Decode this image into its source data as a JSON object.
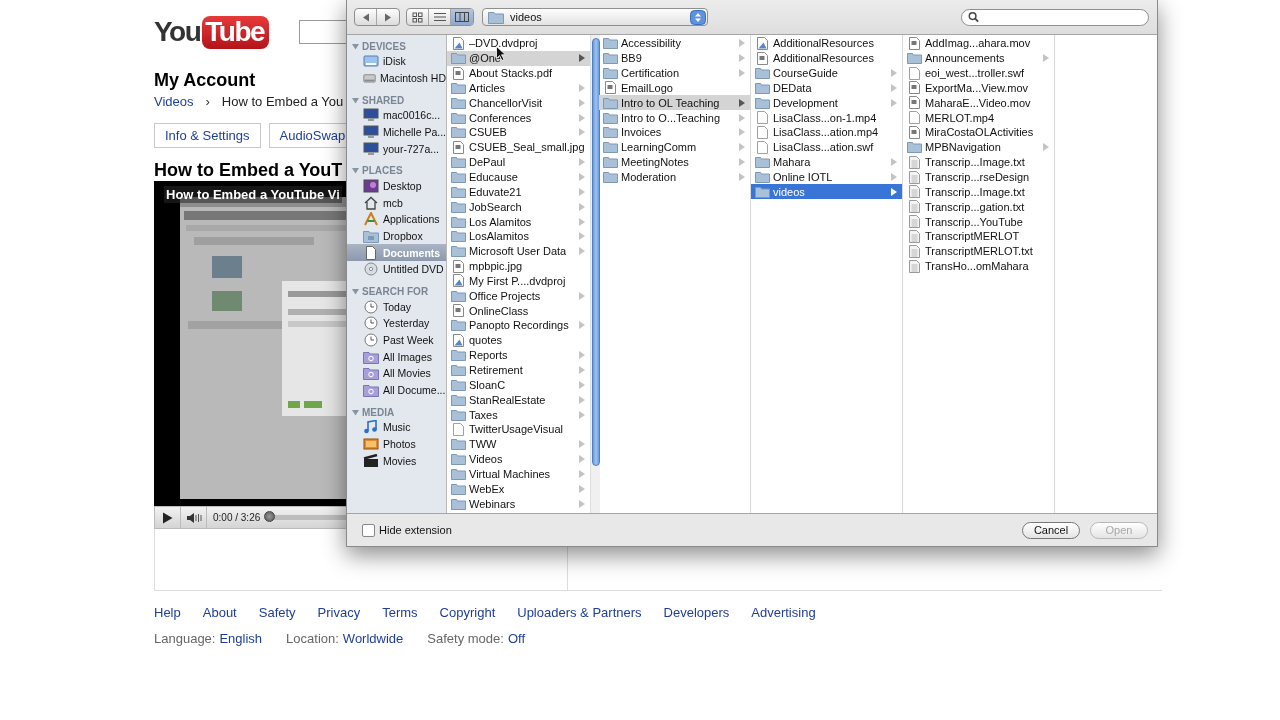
{
  "youtube": {
    "logo": {
      "you": "You",
      "tube": "Tube"
    },
    "heading": "My Account",
    "breadcrumb": {
      "link": "Videos",
      "separator": "›",
      "current": "How to Embed a You"
    },
    "tabs": [
      {
        "label": "Info & Settings"
      },
      {
        "label": "AudioSwap"
      }
    ],
    "video_title": "How to Embed a YouT",
    "player": {
      "overlay_title": "How to Embed a YouTube Vi",
      "time": "0:00 / 3:26"
    },
    "footer_links": [
      "Help",
      "About",
      "Safety",
      "Privacy",
      "Terms",
      "Copyright",
      "Uploaders & Partners",
      "Developers",
      "Advertising"
    ],
    "footer_settings": [
      {
        "label": "Language:",
        "value": "English"
      },
      {
        "label": "Location:",
        "value": "Worldwide"
      },
      {
        "label": "Safety mode:",
        "value": "Off"
      }
    ]
  },
  "dialog": {
    "views": [
      {
        "kind": "icon",
        "selected": false
      },
      {
        "kind": "list",
        "selected": false
      },
      {
        "kind": "columns",
        "selected": true
      }
    ],
    "path": "videos",
    "sidebar": [
      {
        "title": "DEVICES",
        "expanded": true,
        "items": [
          {
            "label": "iDisk",
            "kind": "idisk",
            "selected": false
          },
          {
            "label": "Macintosh HD",
            "kind": "harddisk",
            "selected": false
          }
        ]
      },
      {
        "title": "SHARED",
        "expanded": true,
        "items": [
          {
            "label": "mac0016c...",
            "kind": "computer",
            "selected": false
          },
          {
            "label": "Michelle Pa...",
            "kind": "computer",
            "selected": false
          },
          {
            "label": "your-727a...",
            "kind": "computer",
            "selected": false
          }
        ]
      },
      {
        "title": "PLACES",
        "expanded": true,
        "items": [
          {
            "label": "Desktop",
            "kind": "desktop",
            "selected": false
          },
          {
            "label": "mcb",
            "kind": "home",
            "selected": false
          },
          {
            "label": "Applications",
            "kind": "applications",
            "selected": false
          },
          {
            "label": "Dropbox",
            "kind": "folder",
            "selected": false
          },
          {
            "label": "Documents",
            "kind": "documents",
            "selected": true
          },
          {
            "label": "Untitled DVD",
            "kind": "dvd",
            "selected": false
          }
        ]
      },
      {
        "title": "SEARCH FOR",
        "expanded": true,
        "items": [
          {
            "label": "Today",
            "kind": "clock",
            "selected": false
          },
          {
            "label": "Yesterday",
            "kind": "clock",
            "selected": false
          },
          {
            "label": "Past Week",
            "kind": "clock",
            "selected": false
          },
          {
            "label": "All Images",
            "kind": "smart",
            "selected": false
          },
          {
            "label": "All Movies",
            "kind": "smart",
            "selected": false
          },
          {
            "label": "All Docume...",
            "kind": "smart",
            "selected": false
          }
        ]
      },
      {
        "title": "MEDIA",
        "expanded": true,
        "items": [
          {
            "label": "Music",
            "kind": "music",
            "selected": false
          },
          {
            "label": "Photos",
            "kind": "photos",
            "selected": false
          },
          {
            "label": "Movies",
            "kind": "movies",
            "selected": false
          }
        ]
      }
    ],
    "columns": [
      {
        "items": [
          {
            "name": "–DVD.dvdproj",
            "kind": "project",
            "selected": false
          },
          {
            "name": "@One",
            "kind": "folder",
            "selected": true
          },
          {
            "name": "About Stacks.pdf",
            "kind": "document",
            "selected": false
          },
          {
            "name": "Articles",
            "kind": "folder",
            "selected": false
          },
          {
            "name": "ChancellorVisit",
            "kind": "folder",
            "selected": false
          },
          {
            "name": "Conferences",
            "kind": "folder",
            "selected": false
          },
          {
            "name": "CSUEB",
            "kind": "folder",
            "selected": false
          },
          {
            "name": "CSUEB_Seal_small.jpg",
            "kind": "document",
            "selected": false
          },
          {
            "name": "DePaul",
            "kind": "folder",
            "selected": false
          },
          {
            "name": "Educause",
            "kind": "folder",
            "selected": false
          },
          {
            "name": "Eduvate21",
            "kind": "folder",
            "selected": false
          },
          {
            "name": "JobSearch",
            "kind": "folder",
            "selected": false
          },
          {
            "name": "Los Alamitos",
            "kind": "folder",
            "selected": false
          },
          {
            "name": "LosAlamitos",
            "kind": "folder",
            "selected": false
          },
          {
            "name": "Microsoft User Data",
            "kind": "folder",
            "selected": false
          },
          {
            "name": "mpbpic.jpg",
            "kind": "document",
            "selected": false
          },
          {
            "name": "My First P....dvdproj",
            "kind": "project",
            "selected": false
          },
          {
            "name": "Office Projects",
            "kind": "folder",
            "selected": false
          },
          {
            "name": "OnlineClass",
            "kind": "document",
            "selected": false
          },
          {
            "name": "Panopto Recordings",
            "kind": "folder",
            "selected": false
          },
          {
            "name": "quotes",
            "kind": "project",
            "selected": false
          },
          {
            "name": "Reports",
            "kind": "folder",
            "selected": false
          },
          {
            "name": "Retirement",
            "kind": "folder",
            "selected": false
          },
          {
            "name": "SloanC",
            "kind": "folder",
            "selected": false
          },
          {
            "name": "StanRealEstate",
            "kind": "folder",
            "selected": false
          },
          {
            "name": "Taxes",
            "kind": "folder",
            "selected": false
          },
          {
            "name": "TwitterUsageVisual",
            "kind": "file",
            "selected": false
          },
          {
            "name": "TWW",
            "kind": "folder",
            "selected": false
          },
          {
            "name": "Videos",
            "kind": "folder",
            "selected": false
          },
          {
            "name": "Virtual Machines",
            "kind": "folder",
            "selected": false
          },
          {
            "name": "WebEx",
            "kind": "folder",
            "selected": false
          },
          {
            "name": "Webinars",
            "kind": "folder",
            "selected": false
          }
        ]
      },
      {
        "items": [
          {
            "name": "Accessibility",
            "kind": "folder",
            "selected": false
          },
          {
            "name": "BB9",
            "kind": "folder",
            "selected": false
          },
          {
            "name": "Certification",
            "kind": "folder",
            "selected": false
          },
          {
            "name": "EmailLogo",
            "kind": "document",
            "selected": false
          },
          {
            "name": "Intro to OL Teaching",
            "kind": "folder",
            "selected": true
          },
          {
            "name": "Intro to O...Teaching",
            "kind": "folder",
            "selected": false
          },
          {
            "name": "Invoices",
            "kind": "folder",
            "selected": false
          },
          {
            "name": "LearningComm",
            "kind": "folder",
            "selected": false
          },
          {
            "name": "MeetingNotes",
            "kind": "folder",
            "selected": false
          },
          {
            "name": "Moderation",
            "kind": "folder",
            "selected": false
          }
        ]
      },
      {
        "items": [
          {
            "name": "AdditionalResources",
            "kind": "project",
            "selected": false
          },
          {
            "name": "AdditionalResources",
            "kind": "document",
            "selected": false
          },
          {
            "name": "CourseGuide",
            "kind": "folder",
            "selected": false
          },
          {
            "name": "DEData",
            "kind": "folder",
            "selected": false
          },
          {
            "name": "Development",
            "kind": "folder",
            "selected": false
          },
          {
            "name": "LisaClass...on-1.mp4",
            "kind": "file",
            "selected": false
          },
          {
            "name": "LisaClass...ation.mp4",
            "kind": "file",
            "selected": false
          },
          {
            "name": "LisaClass...ation.swf",
            "kind": "file",
            "selected": false
          },
          {
            "name": "Mahara",
            "kind": "folder",
            "selected": false
          },
          {
            "name": "Online IOTL",
            "kind": "folder",
            "selected": false
          },
          {
            "name": "videos",
            "kind": "folder",
            "selected": true
          }
        ]
      },
      {
        "items": [
          {
            "name": "AddImag...ahara.mov",
            "kind": "document",
            "selected": false
          },
          {
            "name": "Announcements",
            "kind": "folder",
            "selected": false
          },
          {
            "name": "eoi_west...troller.swf",
            "kind": "file",
            "selected": false
          },
          {
            "name": "ExportMa...View.mov",
            "kind": "document",
            "selected": false
          },
          {
            "name": "MaharaE...Video.mov",
            "kind": "document",
            "selected": false
          },
          {
            "name": "MERLOT.mp4",
            "kind": "file",
            "selected": false
          },
          {
            "name": "MiraCostaOLActivities",
            "kind": "document",
            "selected": false
          },
          {
            "name": "MPBNavigation",
            "kind": "folder",
            "selected": false
          },
          {
            "name": "Transcrip...Image.txt",
            "kind": "text",
            "selected": false
          },
          {
            "name": "Transcrip...rseDesign",
            "kind": "text",
            "selected": false
          },
          {
            "name": "Transcrip...Image.txt",
            "kind": "text",
            "selected": false
          },
          {
            "name": "Transcrip...gation.txt",
            "kind": "text",
            "selected": false
          },
          {
            "name": "Transcrip...YouTube",
            "kind": "text",
            "selected": false
          },
          {
            "name": "TranscriptMERLOT",
            "kind": "text",
            "selected": false
          },
          {
            "name": "TranscriptMERLOT.txt",
            "kind": "text",
            "selected": false
          },
          {
            "name": "TransHo...omMahara",
            "kind": "text",
            "selected": false
          }
        ]
      }
    ],
    "hide_extension": {
      "label": "Hide extension",
      "checked": false
    },
    "buttons": [
      {
        "label": "Cancel",
        "disabled": false
      },
      {
        "label": "Open",
        "disabled": true
      }
    ]
  }
}
